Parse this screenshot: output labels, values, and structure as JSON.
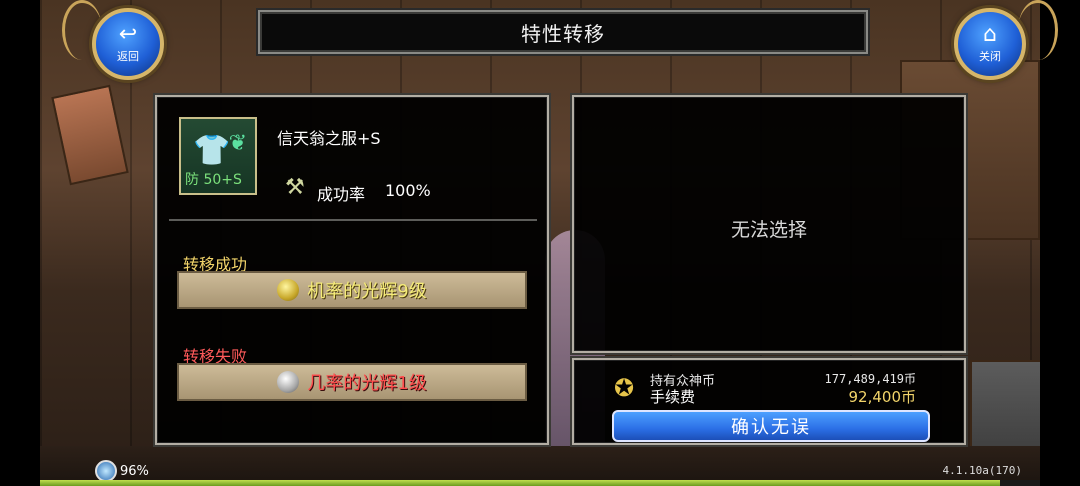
{
  "nav": {
    "back_label": "返回",
    "close_label": "关闭"
  },
  "title": "特性转移",
  "item": {
    "name": "信天翁之服+S",
    "defense_label": "防 50+S",
    "success_rate_label": "成功率",
    "success_rate_value": "100%"
  },
  "transfer": {
    "success_label": "转移成功",
    "success_result": "机率的光辉9级",
    "fail_label": "转移失败",
    "fail_result": "几率的光辉1级"
  },
  "target_panel": {
    "empty_text": "无法选择"
  },
  "cost": {
    "holding_label": "持有众神币",
    "holding_value": "177,489,419币",
    "fee_label": "手续费",
    "fee_value": "92,400币",
    "confirm_label": "确认无误"
  },
  "status": {
    "battery": "96%",
    "battery_fraction": 0.96,
    "version": "4.1.10a(170)"
  },
  "colors": {
    "success": "#f2d46a",
    "fail": "#ff5a5a",
    "button_blue": "#2b6fe6"
  },
  "icons": [
    "back-arrow-icon",
    "home-icon",
    "armor-icon",
    "hammer-icon",
    "gold-orb-icon",
    "silver-orb-icon",
    "coin-icon"
  ]
}
